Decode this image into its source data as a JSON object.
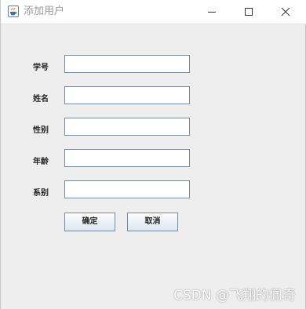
{
  "window": {
    "title": "添加用户",
    "app_icon": "java-cup-icon",
    "controls": {
      "minimize_icon": "minimize-icon",
      "maximize_icon": "maximize-icon",
      "close_icon": "close-icon"
    }
  },
  "form": {
    "fields": [
      {
        "label": "学号",
        "value": ""
      },
      {
        "label": "姓名",
        "value": ""
      },
      {
        "label": "性别",
        "value": ""
      },
      {
        "label": "年龄",
        "value": ""
      },
      {
        "label": "系别",
        "value": ""
      }
    ],
    "ok_label": "确定",
    "cancel_label": "取消"
  },
  "watermark": {
    "text": "CSDN @飞翔的佩奇"
  }
}
